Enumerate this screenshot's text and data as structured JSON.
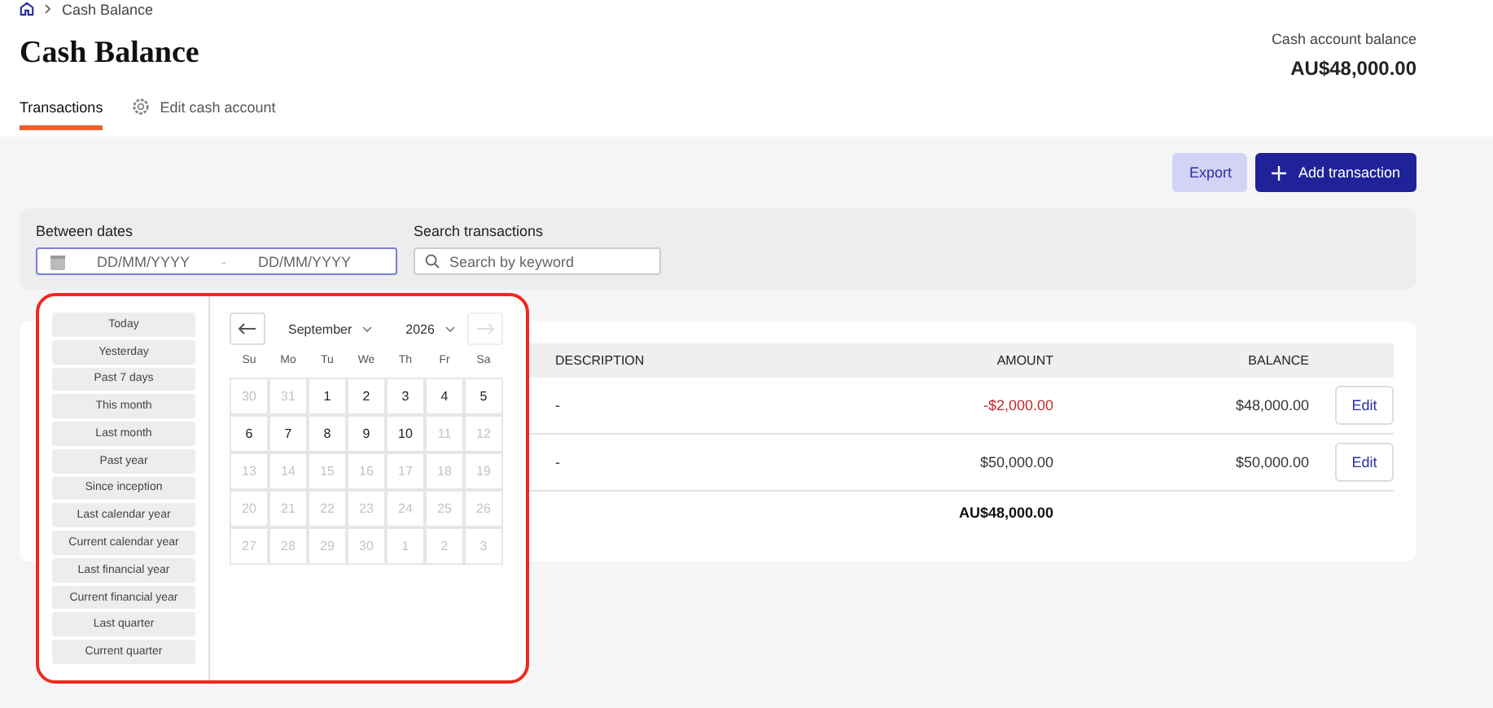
{
  "breadcrumb": {
    "current": "Cash Balance"
  },
  "title": "Cash Balance",
  "balance": {
    "label": "Cash account balance",
    "value": "AU$48,000.00"
  },
  "tabs": [
    {
      "label": "Transactions",
      "selected": true,
      "kind": "plain"
    },
    {
      "label": "Edit cash account",
      "selected": false,
      "kind": "settings"
    }
  ],
  "actions": {
    "export": "Export",
    "add": "Add transaction"
  },
  "filters": {
    "dates_label": "Between dates",
    "from_placeholder": "DD/MM/YYYY",
    "separator": "-",
    "to_placeholder": "DD/MM/YYYY",
    "search_label": "Search transactions",
    "search_placeholder": "Search by keyword"
  },
  "table": {
    "columns": [
      "DESCRIPTION",
      "AMOUNT",
      "BALANCE"
    ],
    "rows": [
      {
        "description": "-",
        "amount": "-$2,000.00",
        "negative": true,
        "balance": "$48,000.00",
        "action": "Edit"
      },
      {
        "description": "-",
        "amount": "$50,000.00",
        "negative": false,
        "balance": "$50,000.00",
        "action": "Edit"
      }
    ],
    "total": "AU$48,000.00"
  },
  "date_picker": {
    "presets": [
      "Today",
      "Yesterday",
      "Past 7 days",
      "This month",
      "Last month",
      "Past year",
      "Since inception",
      "Last calendar year",
      "Current calendar year",
      "Last financial year",
      "Current financial year",
      "Last quarter",
      "Current quarter"
    ],
    "prev_disabled": false,
    "next_disabled": true,
    "month": "September",
    "year": "2026",
    "weekdays": [
      "Su",
      "Mo",
      "Tu",
      "We",
      "Th",
      "Fr",
      "Sa"
    ],
    "days": [
      {
        "label": "30",
        "disabled": true
      },
      {
        "label": "31",
        "disabled": true
      },
      {
        "label": "1",
        "disabled": false
      },
      {
        "label": "2",
        "disabled": false
      },
      {
        "label": "3",
        "disabled": false
      },
      {
        "label": "4",
        "disabled": false
      },
      {
        "label": "5",
        "disabled": false
      },
      {
        "label": "6",
        "disabled": false
      },
      {
        "label": "7",
        "disabled": false
      },
      {
        "label": "8",
        "disabled": false
      },
      {
        "label": "9",
        "disabled": false
      },
      {
        "label": "10",
        "disabled": false
      },
      {
        "label": "11",
        "disabled": true
      },
      {
        "label": "12",
        "disabled": true
      },
      {
        "label": "13",
        "disabled": true
      },
      {
        "label": "14",
        "disabled": true
      },
      {
        "label": "15",
        "disabled": true
      },
      {
        "label": "16",
        "disabled": true
      },
      {
        "label": "17",
        "disabled": true
      },
      {
        "label": "18",
        "disabled": true
      },
      {
        "label": "19",
        "disabled": true
      },
      {
        "label": "20",
        "disabled": true
      },
      {
        "label": "21",
        "disabled": true
      },
      {
        "label": "22",
        "disabled": true
      },
      {
        "label": "23",
        "disabled": true
      },
      {
        "label": "24",
        "disabled": true
      },
      {
        "label": "25",
        "disabled": true
      },
      {
        "label": "26",
        "disabled": true
      },
      {
        "label": "27",
        "disabled": true
      },
      {
        "label": "28",
        "disabled": true
      },
      {
        "label": "29",
        "disabled": true
      },
      {
        "label": "30",
        "disabled": true
      },
      {
        "label": "1",
        "disabled": true
      },
      {
        "label": "2",
        "disabled": true
      },
      {
        "label": "3",
        "disabled": true
      }
    ]
  }
}
